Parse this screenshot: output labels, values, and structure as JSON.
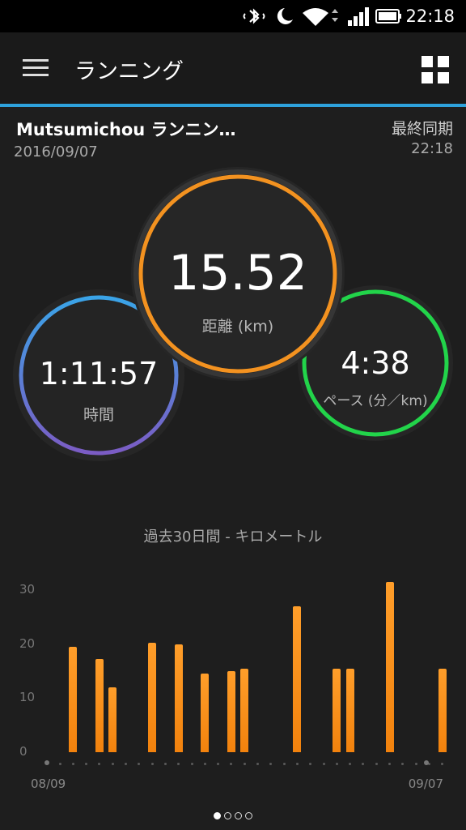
{
  "status_bar": {
    "time": "22:18",
    "icons": [
      "bluetooth-icon",
      "moon-icon",
      "wifi-icon",
      "signal-icon",
      "battery-icon"
    ]
  },
  "app_bar": {
    "title": "ランニング",
    "menu_icon": "menu-icon",
    "grid_icon": "grid-icon"
  },
  "activity": {
    "title": "Mutsumichou ランニン…",
    "date": "2016/09/07",
    "sync_label": "最終同期",
    "sync_time": "22:18"
  },
  "stats": {
    "distance": {
      "value": "15.52",
      "label": "距離 (km)",
      "color": "#f39220"
    },
    "time": {
      "value": "1:11:57",
      "label": "時間",
      "color_top": "#3aa4e8",
      "color_bottom": "#7b5cc4"
    },
    "pace": {
      "value": "4:38",
      "label": "ペース (分／km)",
      "color": "#22d44a"
    }
  },
  "chart_data": {
    "type": "bar",
    "title": "過去30日間 - キロメートル",
    "ylim": [
      0,
      30
    ],
    "yticks": [
      30,
      20,
      10,
      0
    ],
    "x_start_label": "08/09",
    "x_end_label": "09/07",
    "days": 30,
    "bar_color": "#f7901b",
    "values": [
      0,
      19.5,
      0,
      17.2,
      12,
      0,
      0,
      20.3,
      0,
      20,
      0,
      14.5,
      0,
      15,
      15.5,
      0,
      0,
      0,
      27,
      0,
      0,
      15.5,
      15.5,
      0,
      0,
      31.5,
      0,
      0,
      0,
      15.5
    ]
  },
  "pager": {
    "pages": 4,
    "active": 0
  }
}
